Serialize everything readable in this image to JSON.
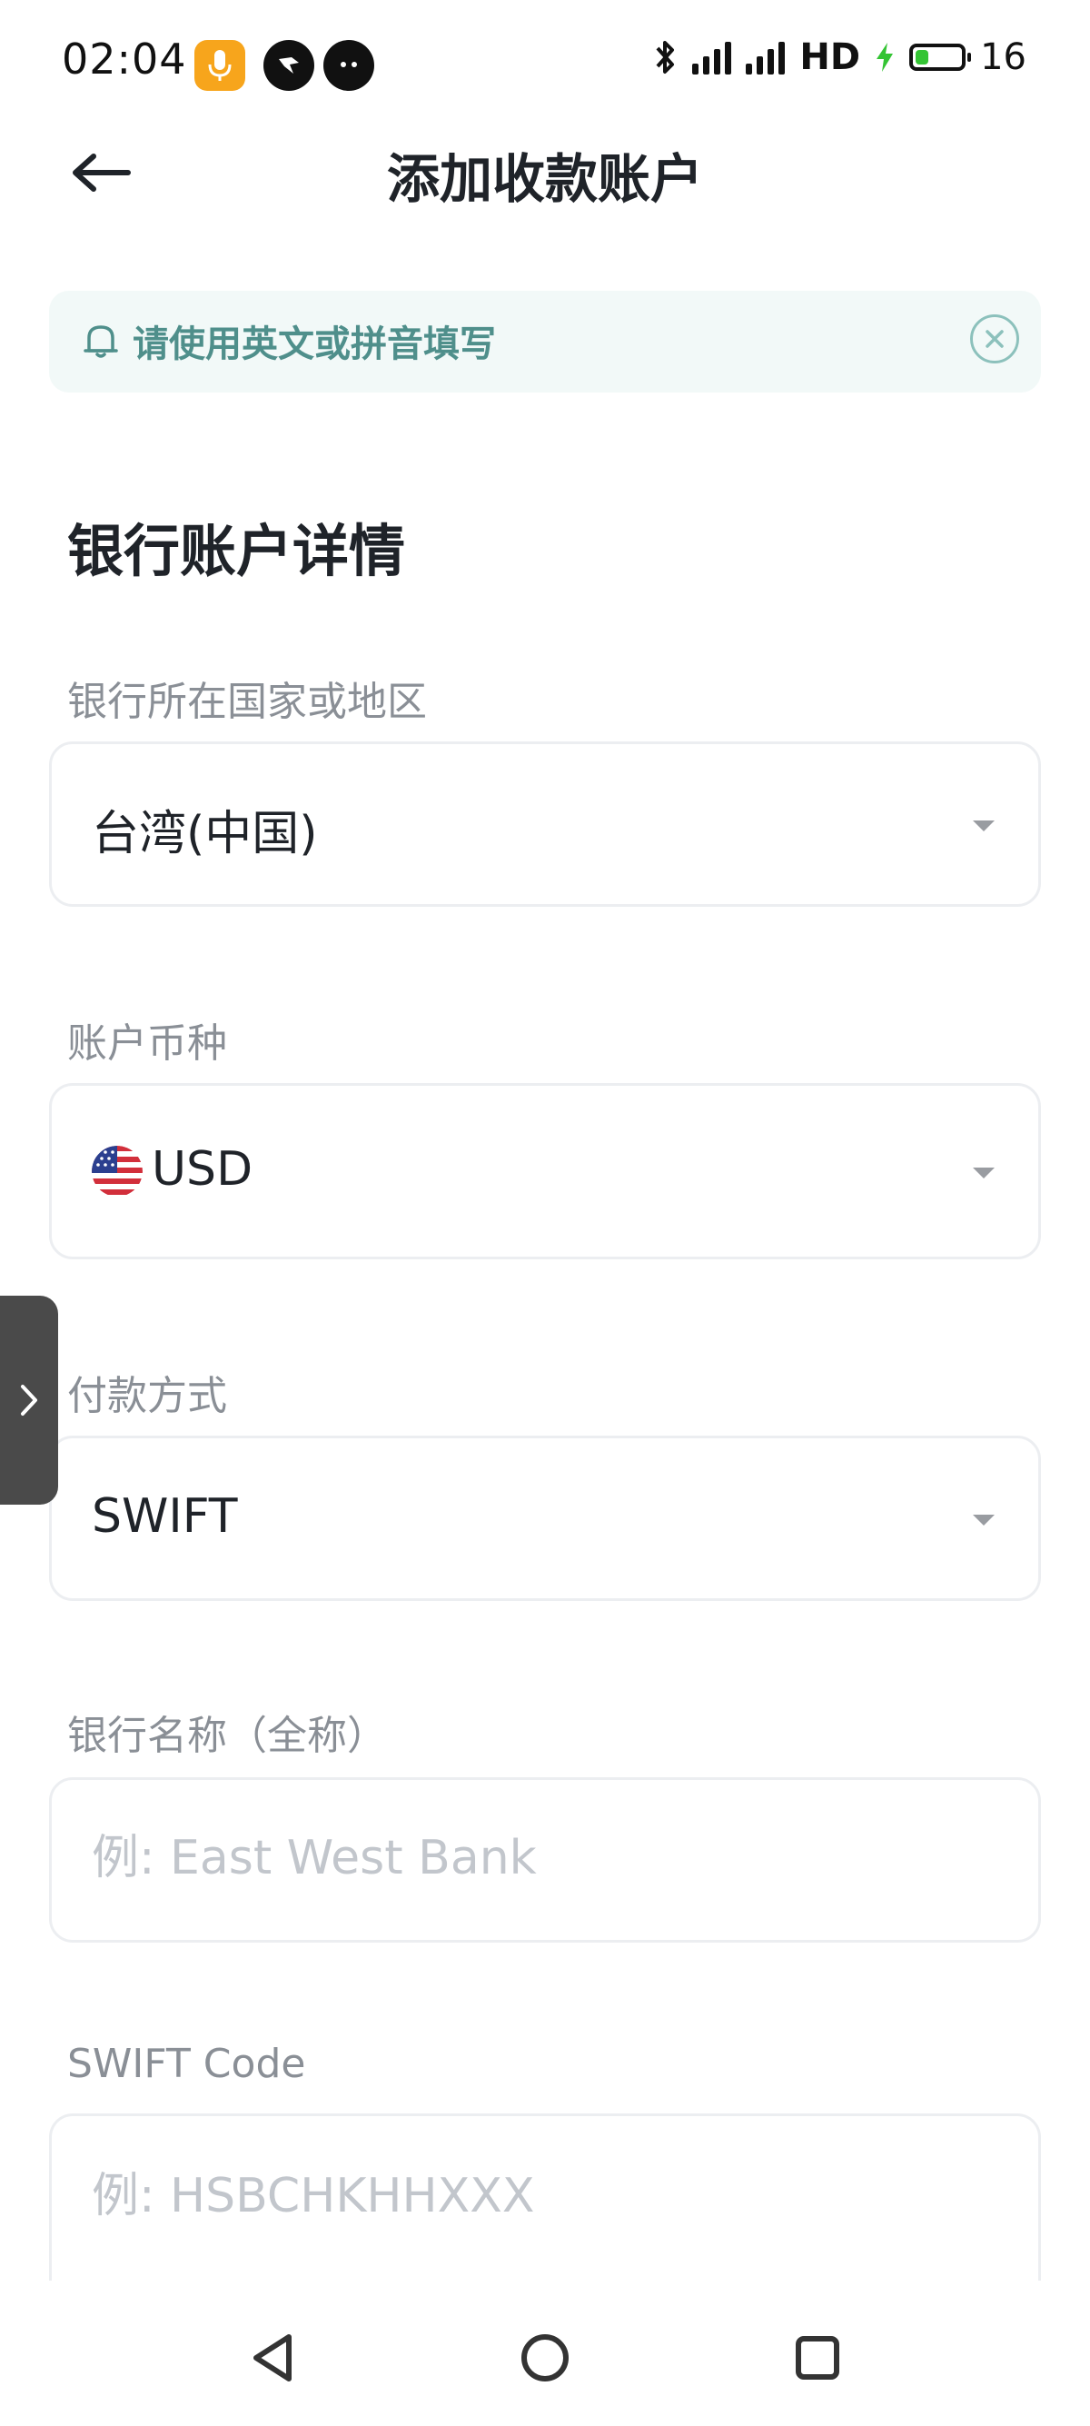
{
  "status_bar": {
    "time": "02:04",
    "network_label": "HD",
    "battery_level": "16"
  },
  "header": {
    "title": "添加收款账户"
  },
  "notice": {
    "text": "请使用英文或拼音填写"
  },
  "section": {
    "title": "银行账户详情"
  },
  "fields": {
    "country": {
      "label": "银行所在国家或地区",
      "value": "台湾(中国)"
    },
    "currency": {
      "label": "账户币种",
      "value": "USD"
    },
    "payment_method": {
      "label": "付款方式",
      "value": "SWIFT"
    },
    "bank_name": {
      "label": "银行名称（全称）",
      "placeholder": "例: East West Bank"
    },
    "swift_code": {
      "label": "SWIFT Code",
      "placeholder": "例: HSBCHKHHXXX"
    }
  },
  "colors": {
    "accent": "#4f8f8b",
    "notice_bg": "#f2f9f8",
    "border": "#eceef1",
    "placeholder": "#c2c6cc",
    "battery_green": "#33c433"
  }
}
